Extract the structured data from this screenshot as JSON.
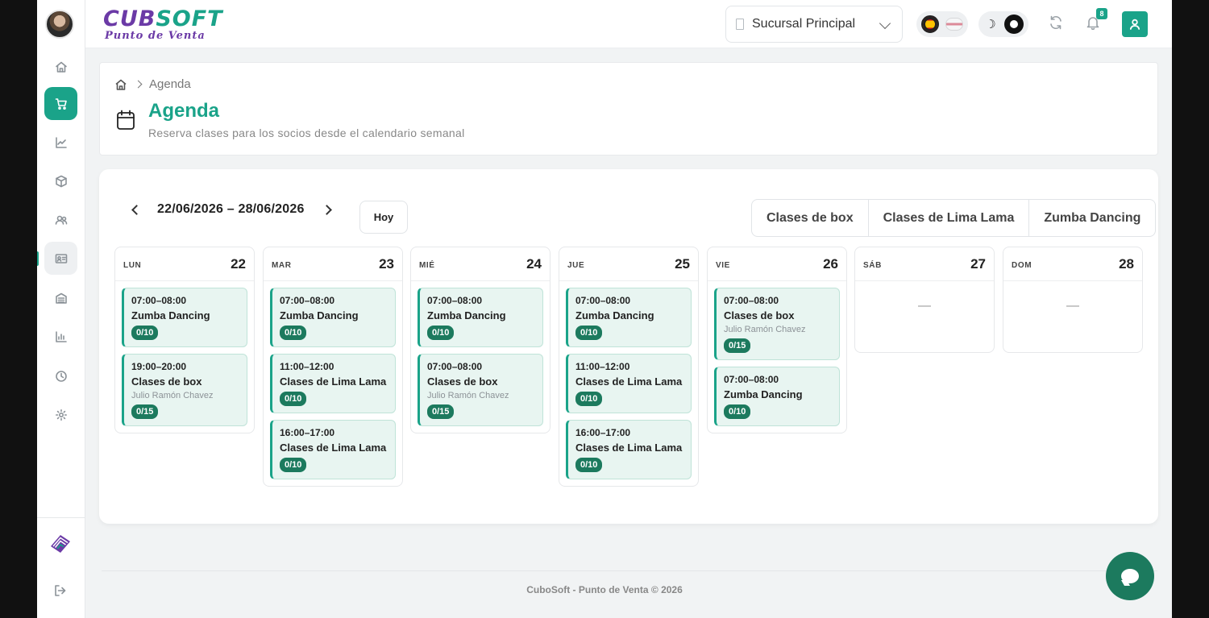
{
  "app": {
    "logo_main_a": "CUB",
    "logo_main_b": "SOFT",
    "logo_sub": "Punto de Venta"
  },
  "header": {
    "branch": "Sucursal Principal",
    "notifications_count": "8"
  },
  "page": {
    "breadcrumb": "Agenda",
    "title": "Agenda",
    "subtitle": "Reserva clases para los socios desde el calendario semanal"
  },
  "calendar": {
    "range": "22/06/2026 – 28/06/2026",
    "today_label": "Hoy",
    "filters": [
      "Clases de box",
      "Clases de Lima Lama",
      "Zumba Dancing"
    ],
    "empty_mark": "—",
    "days": [
      {
        "name": "LUN",
        "num": "22",
        "events": [
          {
            "time": "07:00–08:00",
            "title": "Zumba Dancing",
            "coach": "",
            "cap": "0/10"
          },
          {
            "time": "19:00–20:00",
            "title": "Clases de box",
            "coach": "Julio Ramón Chavez",
            "cap": "0/15"
          }
        ]
      },
      {
        "name": "MAR",
        "num": "23",
        "events": [
          {
            "time": "07:00–08:00",
            "title": "Zumba Dancing",
            "coach": "",
            "cap": "0/10"
          },
          {
            "time": "11:00–12:00",
            "title": "Clases de Lima Lama",
            "coach": "",
            "cap": "0/10"
          },
          {
            "time": "16:00–17:00",
            "title": "Clases de Lima Lama",
            "coach": "",
            "cap": "0/10"
          }
        ]
      },
      {
        "name": "MIÉ",
        "num": "24",
        "events": [
          {
            "time": "07:00–08:00",
            "title": "Zumba Dancing",
            "coach": "",
            "cap": "0/10"
          },
          {
            "time": "07:00–08:00",
            "title": "Clases de box",
            "coach": "Julio Ramón Chavez",
            "cap": "0/15"
          }
        ]
      },
      {
        "name": "JUE",
        "num": "25",
        "events": [
          {
            "time": "07:00–08:00",
            "title": "Zumba Dancing",
            "coach": "",
            "cap": "0/10"
          },
          {
            "time": "11:00–12:00",
            "title": "Clases de Lima Lama",
            "coach": "",
            "cap": "0/10"
          },
          {
            "time": "16:00–17:00",
            "title": "Clases de Lima Lama",
            "coach": "",
            "cap": "0/10"
          }
        ]
      },
      {
        "name": "VIE",
        "num": "26",
        "events": [
          {
            "time": "07:00–08:00",
            "title": "Clases de box",
            "coach": "Julio Ramón Chavez",
            "cap": "0/15"
          },
          {
            "time": "07:00–08:00",
            "title": "Zumba Dancing",
            "coach": "",
            "cap": "0/10"
          }
        ]
      },
      {
        "name": "SÁB",
        "num": "27",
        "events": []
      },
      {
        "name": "DOM",
        "num": "28",
        "events": []
      }
    ]
  },
  "footer": {
    "text": "CuboSoft - Punto de Venta © 2026"
  },
  "colors": {
    "accent": "#1aa389",
    "accent_dark": "#1c7a5e",
    "brand": "#6b3aa6"
  },
  "icons": {
    "sidebar": [
      "home-icon",
      "cart-icon",
      "chart-line-icon",
      "box-icon",
      "users-icon",
      "id-card-icon",
      "building-icon",
      "bar-chart-icon",
      "clock-icon",
      "gear-icon"
    ]
  }
}
